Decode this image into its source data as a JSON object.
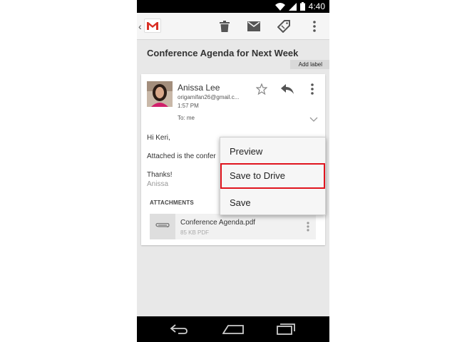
{
  "status_bar": {
    "time": "4:40"
  },
  "action_bar": {
    "back_glyph": "‹",
    "icons": [
      "gmail-logo",
      "trash-icon",
      "archive-icon",
      "label-icon",
      "overflow-icon"
    ]
  },
  "message": {
    "subject": "Conference Agenda for Next Week",
    "add_label": "Add label",
    "sender_name": "Anissa Lee",
    "sender_email": "origamifan26@gmail.c...",
    "time": "1:57 PM",
    "to": "To: me",
    "greeting": "Hi Keri,",
    "body_line": "Attached is the confer",
    "closing": "Thanks!",
    "signature": "Anissa"
  },
  "attachments": {
    "heading": "ATTACHMENTS",
    "items": [
      {
        "name": "Conference Agenda.pdf",
        "meta": "85 KB PDF"
      }
    ]
  },
  "popup_menu": {
    "items": [
      {
        "label": "Preview"
      },
      {
        "label": "Save to Drive",
        "highlighted": true
      },
      {
        "label": "Save"
      }
    ]
  },
  "colors": {
    "highlight_border": "#e0141e",
    "gmail_red": "#d93025",
    "background": "#e8e8e8"
  }
}
